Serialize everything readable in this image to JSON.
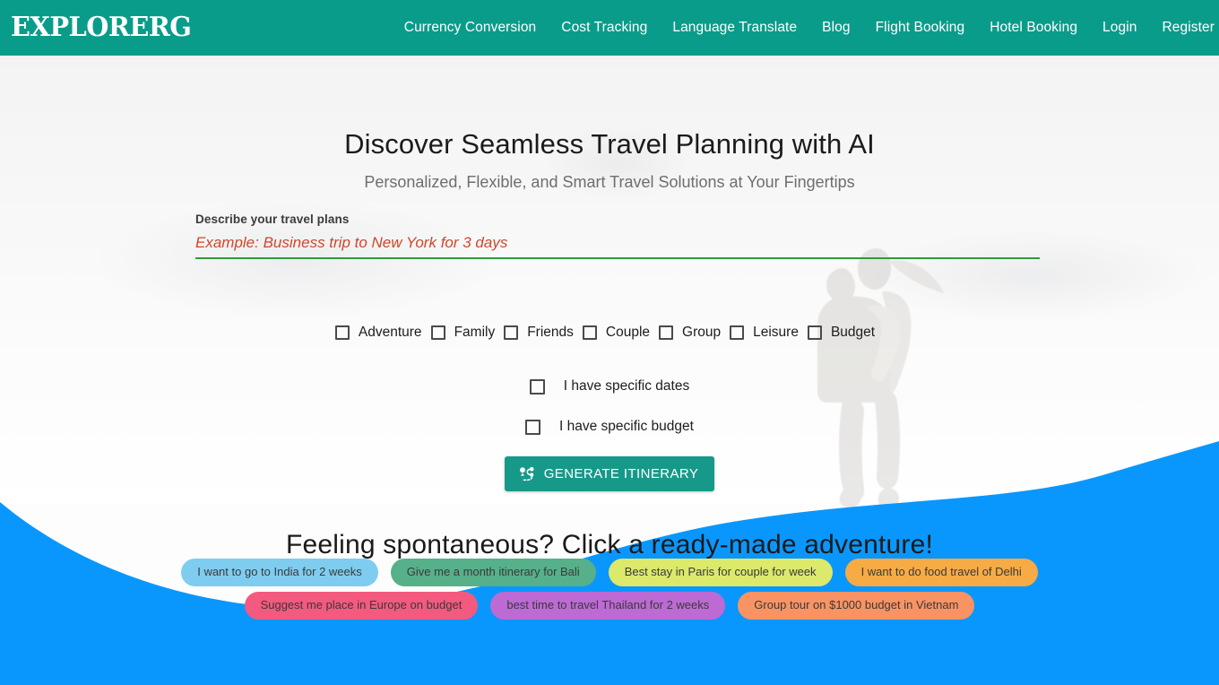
{
  "brand": {
    "name": "EXPLORERG"
  },
  "nav": {
    "items": [
      {
        "label": "Currency Conversion"
      },
      {
        "label": "Cost Tracking"
      },
      {
        "label": "Language Translate"
      },
      {
        "label": "Blog"
      },
      {
        "label": "Flight Booking"
      },
      {
        "label": "Hotel Booking"
      },
      {
        "label": "Login"
      },
      {
        "label": "Register"
      }
    ]
  },
  "hero": {
    "title": "Discover Seamless Travel Planning with AI",
    "subtitle": "Personalized, Flexible, and Smart Travel Solutions at Your Fingertips"
  },
  "form": {
    "label": "Describe your travel plans",
    "value": "",
    "placeholder": "Example: Business trip to New York for 3 days",
    "travel_types": [
      {
        "label": "Adventure",
        "checked": false
      },
      {
        "label": "Family",
        "checked": false
      },
      {
        "label": "Friends",
        "checked": false
      },
      {
        "label": "Couple",
        "checked": false
      },
      {
        "label": "Group",
        "checked": false
      },
      {
        "label": "Leisure",
        "checked": false
      },
      {
        "label": "Budget",
        "checked": false
      }
    ],
    "options": [
      {
        "label": "I have specific dates",
        "checked": false
      },
      {
        "label": "I have specific budget",
        "checked": false
      }
    ],
    "submit_label": "GENERATE ITINERARY",
    "submit_icon": "route-pin-icon"
  },
  "spontaneous": {
    "title": "Feeling spontaneous? Click a ready-made adventure!",
    "chips_row1": [
      {
        "label": "I want to go to India for 2 weeks",
        "color": "#7ecdf0"
      },
      {
        "label": "Give me a month itinerary for Bali",
        "color": "#56b089"
      },
      {
        "label": "Best stay in Paris for couple for week",
        "color": "#dce96a"
      },
      {
        "label": "I want to do food travel of Delhi",
        "color": "#f7ab44"
      }
    ],
    "chips_row2": [
      {
        "label": "Suggest me place in Europe on budget",
        "color": "#f4597f"
      },
      {
        "label": "best time to travel Thailand for 2 weeks",
        "color": "#bd6ad4"
      },
      {
        "label": "Group tour on $1000 budget in Vietnam",
        "color": "#f99364"
      }
    ]
  },
  "colors": {
    "nav_teal": "#0a9c8a",
    "wave_blue": "#0a97fd",
    "button_teal": "#17998a",
    "input_underline_green": "#2e9b3c",
    "placeholder_red": "#d0462c"
  }
}
